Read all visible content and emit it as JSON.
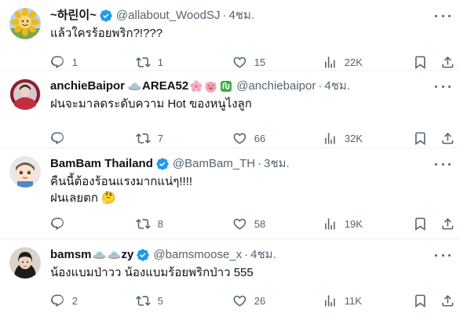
{
  "tweets": [
    {
      "name": "~하린이~",
      "handle": "@allabout_WoodSJ",
      "time": "4ชม.",
      "text_lines": [
        "แล้วใครร้อยพริก?!???"
      ],
      "replies": "1",
      "retweets": "1",
      "likes": "15",
      "views": "22K",
      "avatar_icon": "sunflower-avatar"
    },
    {
      "name": "anchieBaipor",
      "name_suffix": "AREA52",
      "handle": "@anchiebaipor",
      "time": "4ชม.",
      "text_lines": [
        "ฝนจะมาลดระดับความ Hot ของหนูไงลูก"
      ],
      "replies": "",
      "retweets": "7",
      "likes": "66",
      "views": "32K",
      "avatar_icon": "person-avatar"
    },
    {
      "name": "BamBam Thailand",
      "handle": "@BamBam_TH",
      "time": "3ชม.",
      "text_lines": [
        "คืนนี้ต้องร้อนแรงมากแน่ๆ!!!!",
        "ฝนเลยตก 🤔"
      ],
      "replies": "",
      "retweets": "8",
      "likes": "58",
      "views": "19K",
      "avatar_icon": "cartoon-avatar"
    },
    {
      "name": "bamsm",
      "name_suffix": "zy",
      "handle": "@bamsmoose_x",
      "time": "4ชม.",
      "text_lines": [
        "น้องแบมป่าวว น้องแบมร้อยพริกป่าว 555"
      ],
      "replies": "2",
      "retweets": "5",
      "likes": "26",
      "views": "11K",
      "avatar_icon": "person-avatar"
    }
  ],
  "colors": {
    "verified": "#1d9bf0",
    "secondary_text": "#536471",
    "divider": "#eff3f4"
  }
}
